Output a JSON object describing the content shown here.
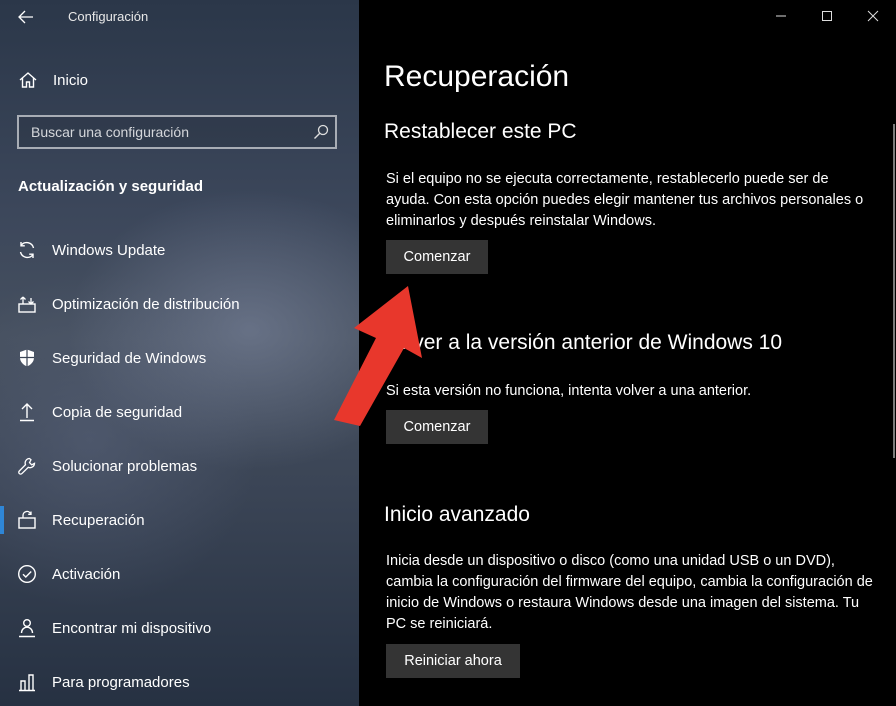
{
  "window": {
    "app_title": "Configuración",
    "controls": [
      "minimize",
      "maximize",
      "close"
    ]
  },
  "sidebar": {
    "home_label": "Inicio",
    "search_placeholder": "Buscar una configuración",
    "section_title": "Actualización y seguridad",
    "items": [
      {
        "label": "Windows Update",
        "icon": "sync-icon"
      },
      {
        "label": "Optimización de distribución",
        "icon": "delivery-optimization-icon"
      },
      {
        "label": "Seguridad de Windows",
        "icon": "shield-icon"
      },
      {
        "label": "Copia de seguridad",
        "icon": "backup-arrow-icon"
      },
      {
        "label": "Solucionar problemas",
        "icon": "wrench-icon"
      },
      {
        "label": "Recuperación",
        "icon": "recovery-icon",
        "selected": true
      },
      {
        "label": "Activación",
        "icon": "check-circle-icon"
      },
      {
        "label": "Encontrar mi dispositivo",
        "icon": "person-pin-icon"
      },
      {
        "label": "Para programadores",
        "icon": "developer-icon"
      }
    ]
  },
  "main": {
    "page_title": "Recuperación",
    "reset": {
      "heading": "Restablecer este PC",
      "description": "Si el equipo no se ejecuta correctamente, restablecerlo puede ser de ayuda. Con esta opción puedes elegir mantener tus archivos personales o eliminarlos y después reinstalar Windows.",
      "button": "Comenzar"
    },
    "rollback": {
      "heading": "Volver a la versión anterior de Windows 10",
      "description": "Si esta versión no funciona, intenta volver a una anterior.",
      "button": "Comenzar"
    },
    "advanced": {
      "heading": "Inicio avanzado",
      "description": "Inicia desde un dispositivo o disco (como una unidad USB o un DVD), cambia la configuración del firmware del equipo, cambia la configuración de inicio de Windows o restaura Windows desde una imagen del sistema. Tu PC se reiniciará.",
      "button": "Reiniciar ahora"
    }
  },
  "colors": {
    "accent": "#2f86d6",
    "annotation_arrow": "#e8372c",
    "button_bg": "#343434"
  }
}
